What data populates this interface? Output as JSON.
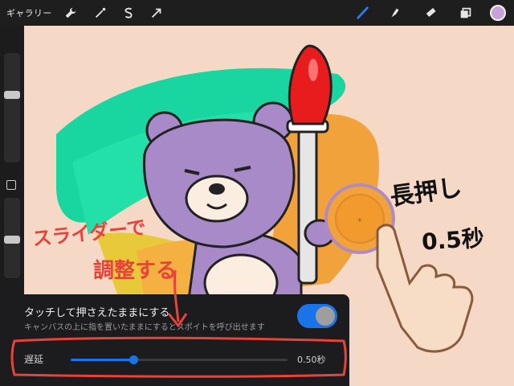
{
  "app": {
    "gallery_label": "ギャラリー",
    "tools_left": [
      "wrench-icon",
      "magic-wand-icon",
      "selection-s-icon",
      "transform-arrow-icon"
    ],
    "tools_right": [
      "brush-icon",
      "smudge-icon",
      "eraser-icon",
      "layers-icon"
    ],
    "current_color": "#c8a2d6"
  },
  "sidebar": {
    "brush_size_level": 0.62,
    "opacity_level": 0.48
  },
  "panel": {
    "title": "タッチして押さえたままにする",
    "description": "キャンバスの上に指を置いたままにするとスポイトを呼び出せます",
    "toggle_on": true,
    "delay_label": "遅延",
    "delay_value": "0.50秒",
    "delay_fraction": 0.29
  },
  "annotations": {
    "slider_hint_line1": "スライダーで",
    "slider_hint_line2": "調整する",
    "long_press_line1": "長押し",
    "long_press_line2": "0.5秒"
  },
  "colors": {
    "accent": "#1a73e8",
    "annotation_red": "#e8433a",
    "bear_purple": "#a98ac9",
    "eyedropper_ring": "#f2a23a"
  }
}
